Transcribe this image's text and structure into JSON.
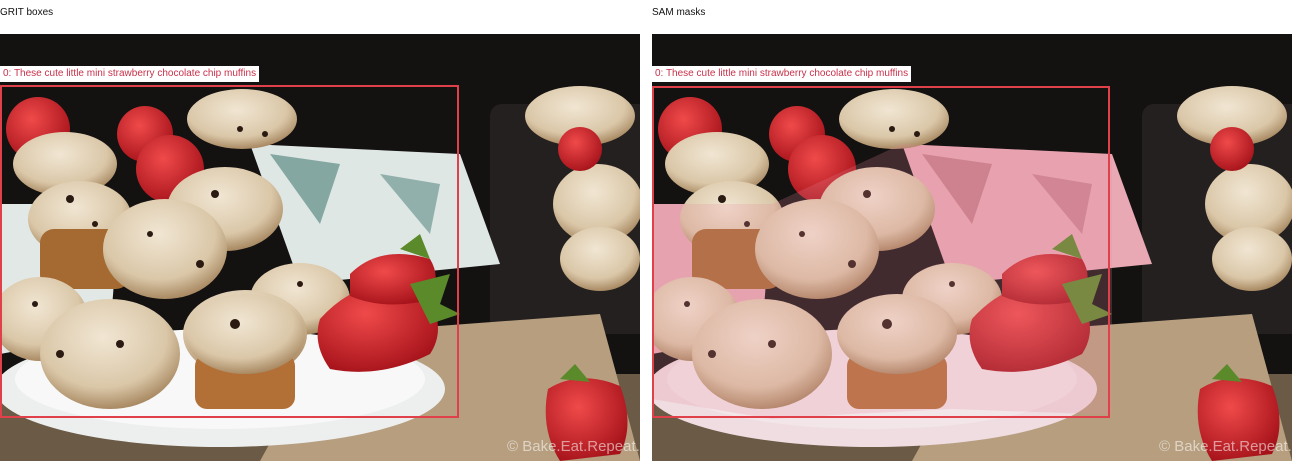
{
  "panels": [
    {
      "title": "GRIT boxes",
      "mode": "box"
    },
    {
      "title": "SAM masks",
      "mode": "mask"
    }
  ],
  "detection": {
    "label": "0: These cute little mini strawberry chocolate chip muffins",
    "box_color": "#e0404a",
    "mask_color": "#e68a9c"
  },
  "watermark": "© Bake.Eat.Repeat."
}
